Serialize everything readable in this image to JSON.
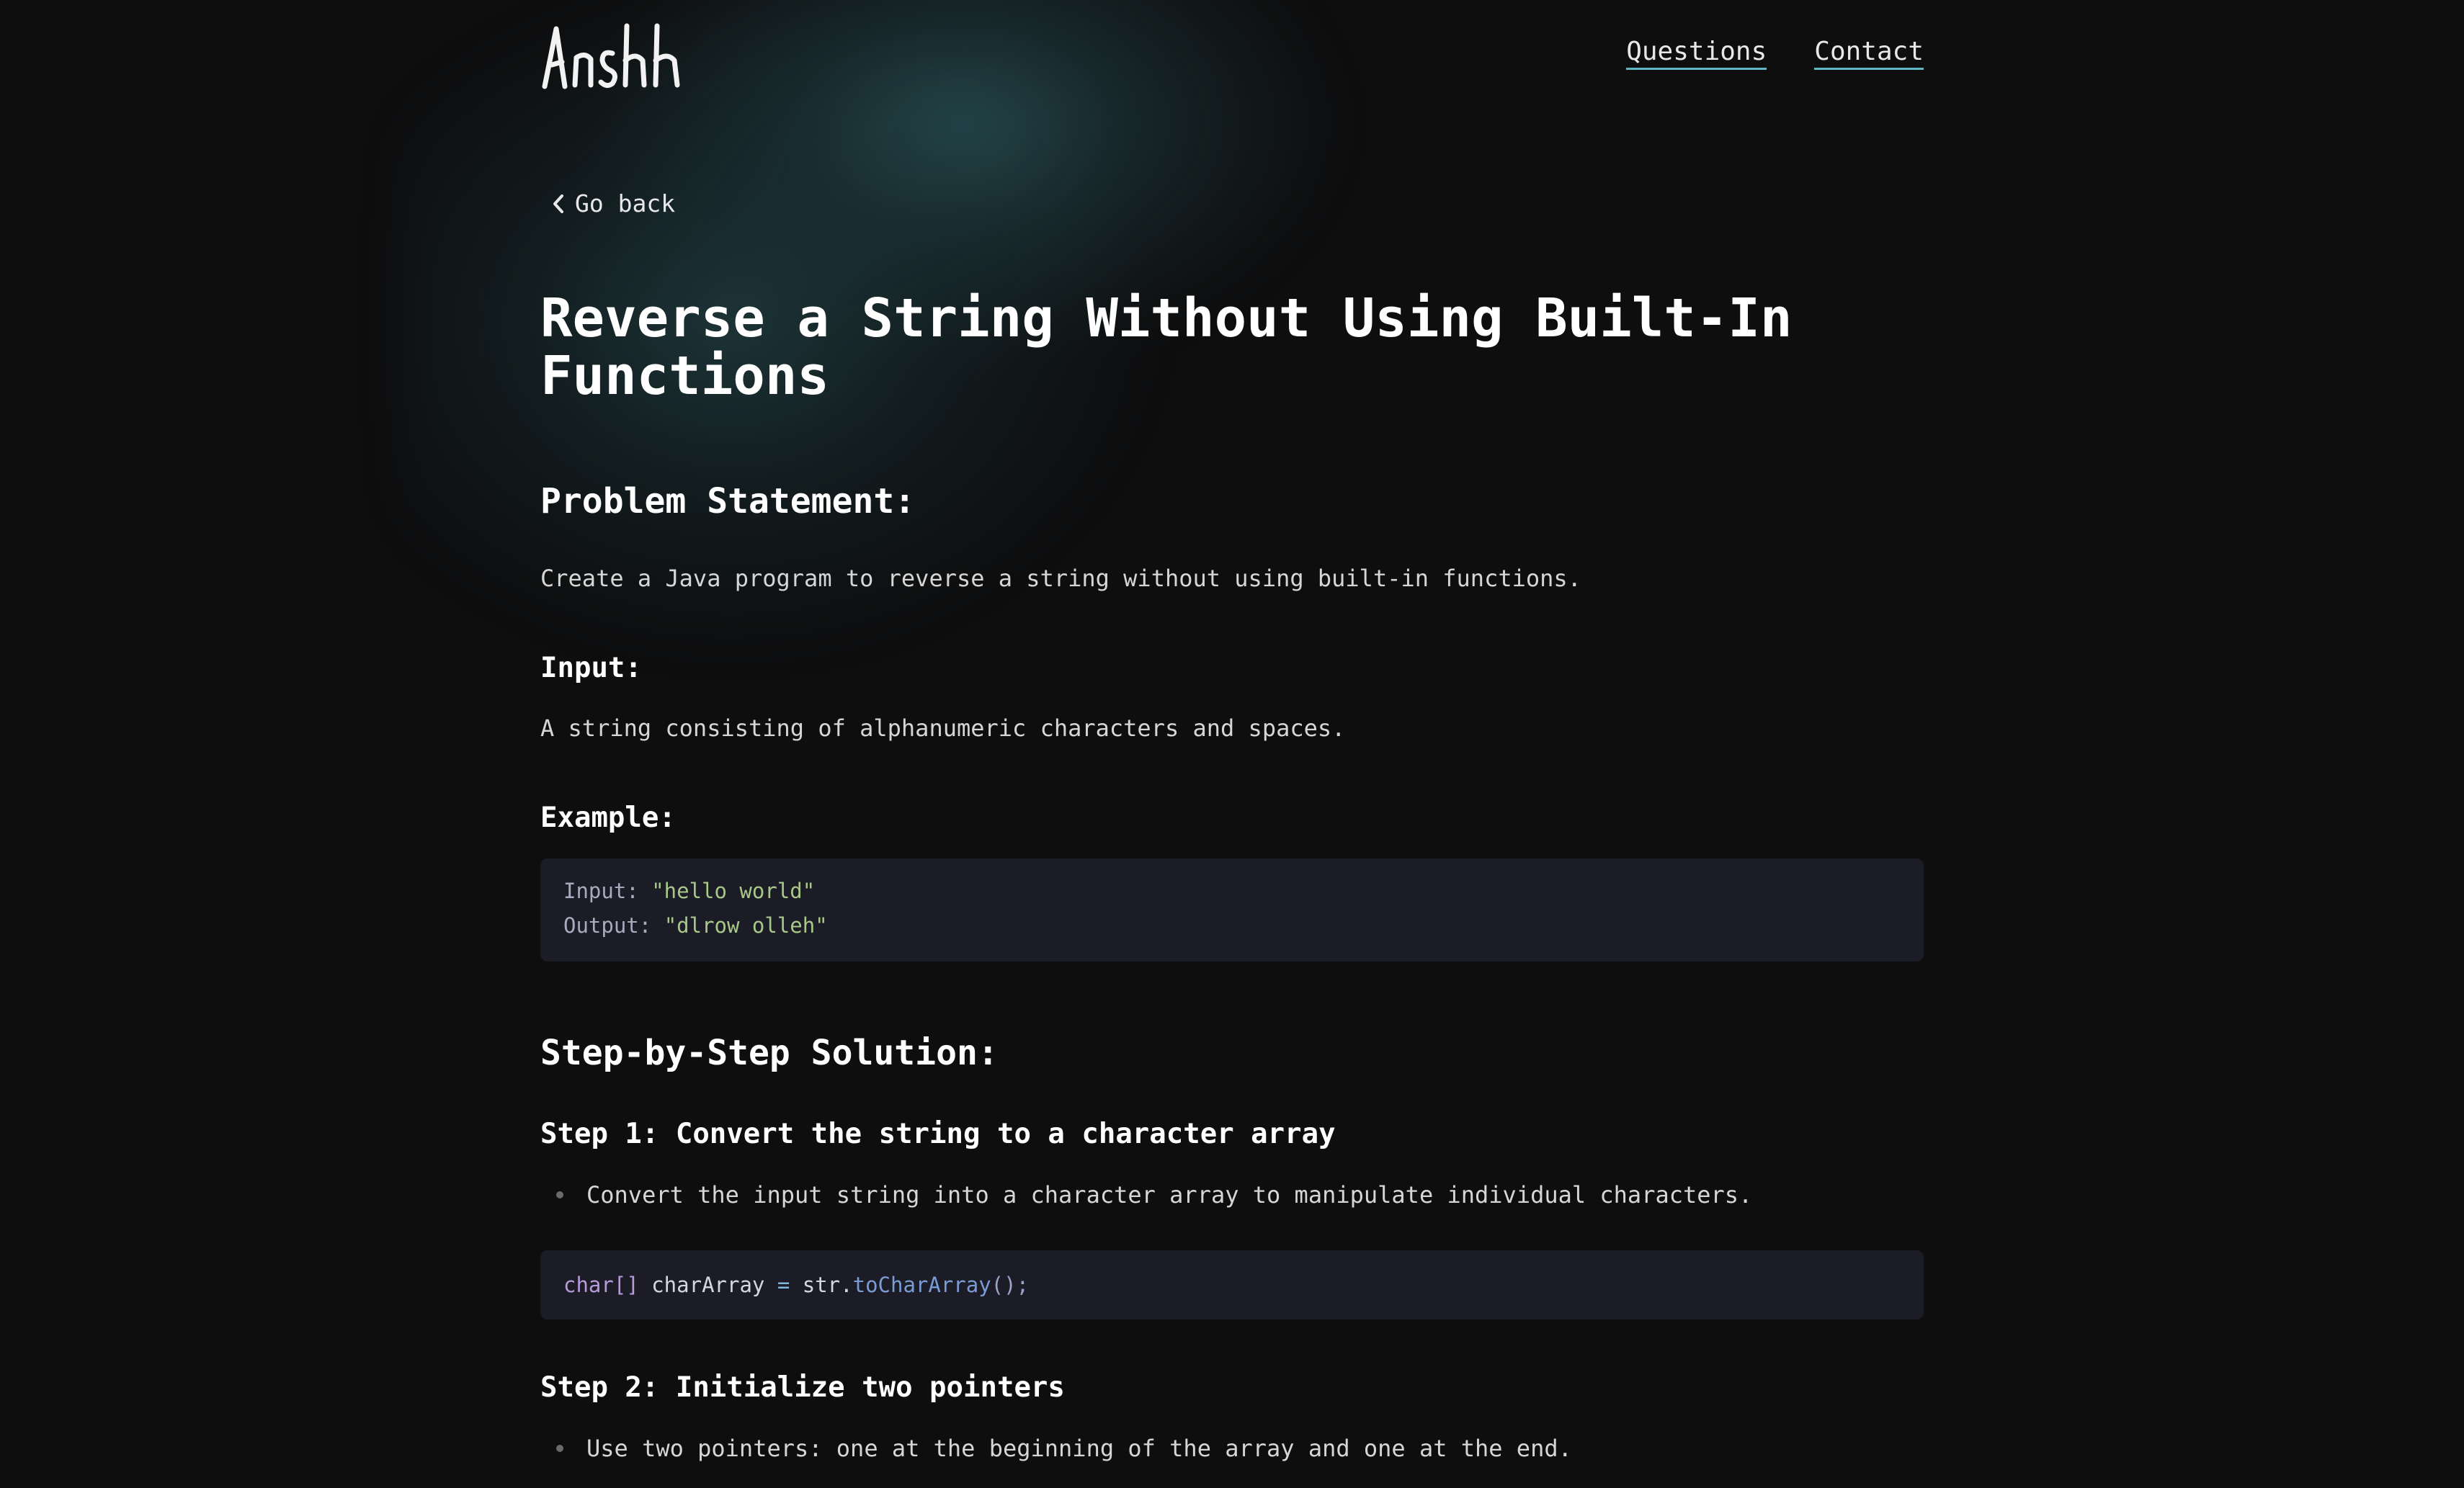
{
  "header": {
    "logo_text": "Anshh",
    "nav": [
      {
        "label": "Questions"
      },
      {
        "label": "Contact"
      }
    ]
  },
  "back_link": {
    "label": "Go back",
    "icon": "chevron-left-icon"
  },
  "article": {
    "title": "Reverse a String Without Using Built-In Functions",
    "problem_heading": "Problem Statement:",
    "problem_text": "Create a Java program to reverse a string without using built-in functions.",
    "input_heading": "Input:",
    "input_text": "A string consisting of alphanumeric characters and spaces.",
    "example_heading": "Example:",
    "example": {
      "input_key": "Input: ",
      "input_value": "\"hello world\"",
      "output_key": "Output: ",
      "output_value": "\"dlrow olleh\""
    },
    "solution_heading": "Step-by-Step Solution:",
    "steps": [
      {
        "heading": "Step 1: Convert the string to a character array",
        "bullet": "Convert the input string into a character array to manipulate individual characters.",
        "code": {
          "type": "char[]",
          "var": " charArray ",
          "op": "=",
          "obj": " str.",
          "fn": "toCharArray",
          "punc": "();"
        }
      },
      {
        "heading": "Step 2: Initialize two pointers",
        "bullet": "Use two pointers: one at the beginning of the array and one at the end."
      }
    ]
  },
  "colors": {
    "background": "#0e0e0f",
    "code_bg": "#1c1c26",
    "link_underline": "#5fb6c4",
    "string": "#a8c88a",
    "type": "#b79ad8",
    "function": "#7a9bd6"
  }
}
